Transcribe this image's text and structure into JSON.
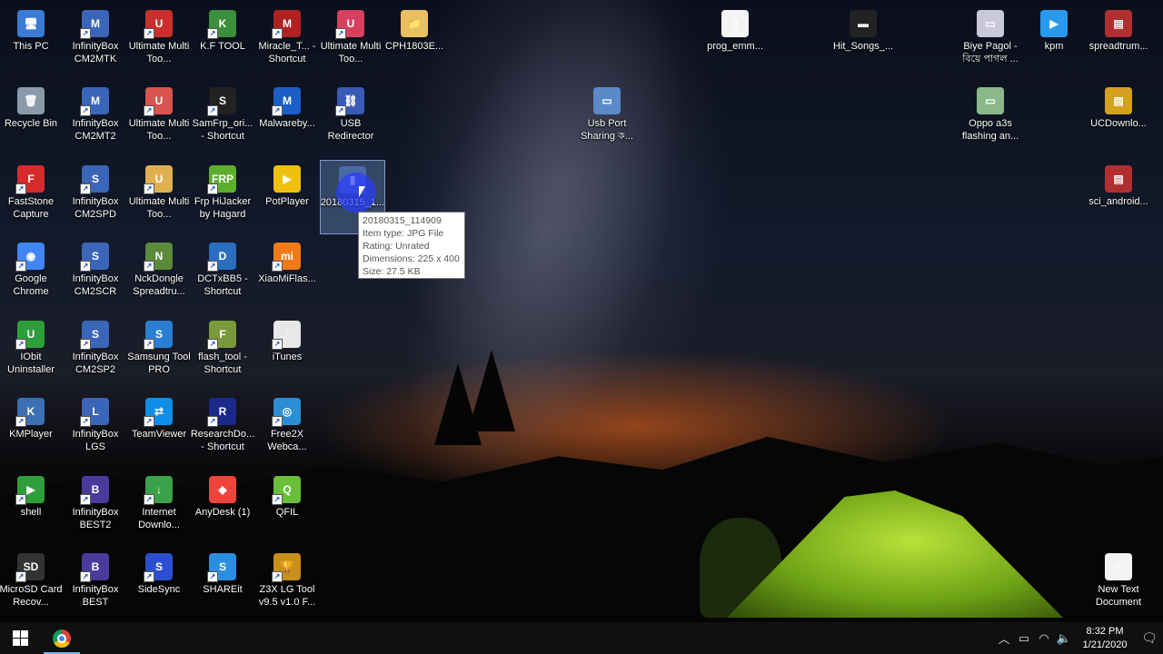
{
  "desktop": {
    "icons": [
      {
        "label": "This PC",
        "glyph": "🖥",
        "color": "#3a7bd5",
        "shortcut": false
      },
      {
        "label": "Recycle Bin",
        "glyph": "🗑",
        "color": "#8a9aa8",
        "shortcut": false
      },
      {
        "label": "FastStone Capture",
        "glyph": "F",
        "color": "#d62b2b",
        "shortcut": true
      },
      {
        "label": "Google Chrome",
        "glyph": "◉",
        "color": "#4285f4",
        "shortcut": true
      },
      {
        "label": "IObit Uninstaller",
        "glyph": "U",
        "color": "#2e9e3a",
        "shortcut": true
      },
      {
        "label": "KMPlayer",
        "glyph": "K",
        "color": "#3c6fb4",
        "shortcut": true
      },
      {
        "label": "shell",
        "glyph": "▶",
        "color": "#2e9e3a",
        "shortcut": true
      },
      {
        "label": "MicroSD Card Recov...",
        "glyph": "SD",
        "color": "#333",
        "shortcut": true
      },
      {
        "label": "InfinityBox CM2MTK",
        "glyph": "M",
        "color": "#3a65b8",
        "shortcut": true
      },
      {
        "label": "InfinityBox CM2MT2",
        "glyph": "M",
        "color": "#3a65b8",
        "shortcut": true
      },
      {
        "label": "InfinityBox CM2SPD",
        "glyph": "S",
        "color": "#3a65b8",
        "shortcut": true
      },
      {
        "label": "InfinityBox CM2SCR",
        "glyph": "S",
        "color": "#3a65b8",
        "shortcut": true
      },
      {
        "label": "InfinityBox CM2SP2",
        "glyph": "S",
        "color": "#3a65b8",
        "shortcut": true
      },
      {
        "label": "InfinityBox LGS",
        "glyph": "L",
        "color": "#3a65b8",
        "shortcut": true
      },
      {
        "label": "InfinityBox BEST2",
        "glyph": "B",
        "color": "#4b3a9c",
        "shortcut": true
      },
      {
        "label": "InfinityBox BEST",
        "glyph": "B",
        "color": "#4b3a9c",
        "shortcut": true
      },
      {
        "label": "Ultimate Multi Too...",
        "glyph": "U",
        "color": "#c9302c",
        "shortcut": true
      },
      {
        "label": "Ultimate Multi Too...",
        "glyph": "U",
        "color": "#d9534f",
        "shortcut": true
      },
      {
        "label": "Ultimate Multi Too...",
        "glyph": "U",
        "color": "#e0b050",
        "shortcut": true
      },
      {
        "label": "NckDongle Spreadtru...",
        "glyph": "N",
        "color": "#5a8a3a",
        "shortcut": true
      },
      {
        "label": "Samsung Tool PRO",
        "glyph": "S",
        "color": "#2a7fd4",
        "shortcut": true
      },
      {
        "label": "TeamViewer",
        "glyph": "⇄",
        "color": "#0e8ee9",
        "shortcut": true
      },
      {
        "label": "Internet Downlo...",
        "glyph": "↓",
        "color": "#3aa04a",
        "shortcut": true
      },
      {
        "label": "SideSync",
        "glyph": "S",
        "color": "#2c4fd1",
        "shortcut": true
      },
      {
        "label": "K.F TOOL",
        "glyph": "K",
        "color": "#3b8e3b",
        "shortcut": true
      },
      {
        "label": "SamFrp_ori... - Shortcut",
        "glyph": "S",
        "color": "#222",
        "shortcut": true
      },
      {
        "label": "Frp HiJacker by Hagard",
        "glyph": "FRP",
        "color": "#5cae2c",
        "shortcut": true
      },
      {
        "label": "DCTxBB5 - Shortcut",
        "glyph": "D",
        "color": "#2a6fbf",
        "shortcut": true
      },
      {
        "label": "flash_tool - Shortcut",
        "glyph": "F",
        "color": "#7a9a3a",
        "shortcut": true
      },
      {
        "label": "ResearchDo... - Shortcut",
        "glyph": "R",
        "color": "#1b2a8a",
        "shortcut": true
      },
      {
        "label": "AnyDesk (1)",
        "glyph": "◆",
        "color": "#ef443b",
        "shortcut": false
      },
      {
        "label": "SHAREit",
        "glyph": "S",
        "color": "#2a8fe0",
        "shortcut": true
      },
      {
        "label": "Miracle_T... - Shortcut",
        "glyph": "M",
        "color": "#b02222",
        "shortcut": true
      },
      {
        "label": "Malwareby...",
        "glyph": "M",
        "color": "#1a5fc7",
        "shortcut": true
      },
      {
        "label": "PotPlayer",
        "glyph": "▶",
        "color": "#f0c010",
        "shortcut": false
      },
      {
        "label": "XiaoMiFlas...",
        "glyph": "mi",
        "color": "#f07a18",
        "shortcut": true
      },
      {
        "label": "iTunes",
        "glyph": "♪",
        "color": "#e8e8e8",
        "shortcut": true
      },
      {
        "label": "Free2X Webca...",
        "glyph": "◎",
        "color": "#2a8fd4",
        "shortcut": true
      },
      {
        "label": "QFIL",
        "glyph": "Q",
        "color": "#6abf3a",
        "shortcut": true
      },
      {
        "label": "Z3X LG Tool v9.5 v1.0 F...",
        "glyph": "🏆",
        "color": "#c8901a",
        "shortcut": true
      },
      {
        "label": "Ultimate Multi Too...",
        "glyph": "U",
        "color": "#d94060",
        "shortcut": true
      },
      {
        "label": "USB Redirector",
        "glyph": "⛓",
        "color": "#3a5ab8",
        "shortcut": true
      },
      {
        "label": "20180315_1...",
        "glyph": "▮",
        "color": "#4a6aa8",
        "shortcut": false
      },
      {
        "label": "CPH1803E...",
        "glyph": "📁",
        "color": "#e8c060",
        "shortcut": false
      },
      {
        "label": "prog_emm...",
        "glyph": "▯",
        "color": "#f4f4f4",
        "shortcut": false
      },
      {
        "label": "Usb Port Sharing ক...",
        "glyph": "▭",
        "color": "#5a8ac8",
        "shortcut": false
      },
      {
        "label": "Hit_Songs_...",
        "glyph": "▬",
        "color": "#222",
        "shortcut": false
      },
      {
        "label": "Biye Pagol - বিয়ে পাগল ...",
        "glyph": "▭",
        "color": "#c8c8d8",
        "shortcut": false
      },
      {
        "label": "Oppo a3s flashing an...",
        "glyph": "▭",
        "color": "#8ab88a",
        "shortcut": false
      },
      {
        "label": "kpm",
        "glyph": "▶",
        "color": "#2a9aee",
        "shortcut": false
      },
      {
        "label": "spreadtrum...",
        "glyph": "▤",
        "color": "#b03030",
        "shortcut": false
      },
      {
        "label": "UCDownlo...",
        "glyph": "▤",
        "color": "#d4a020",
        "shortcut": false
      },
      {
        "label": "sci_android...",
        "glyph": "▤",
        "color": "#b03030",
        "shortcut": false
      },
      {
        "label": "New Text Document",
        "glyph": "≡",
        "color": "#f4f4f4",
        "shortcut": false
      }
    ],
    "tooltip": {
      "name": "20180315_114909",
      "type": "Item type: JPG File",
      "rating": "Rating: Unrated",
      "dimensions": "Dimensions: 225 x 400",
      "size": "Size: 27.5 KB"
    }
  },
  "taskbar": {
    "start_icon": "windows-logo-icon",
    "pinned": [
      {
        "name": "Google Chrome",
        "icon": "chrome-icon",
        "active": true
      }
    ],
    "tray_icons": [
      "chevron-up-icon",
      "battery-icon",
      "wifi-icon",
      "volume-icon"
    ],
    "time": "8:32 PM",
    "date": "1/21/2020",
    "notifications_icon": "action-center-icon"
  }
}
